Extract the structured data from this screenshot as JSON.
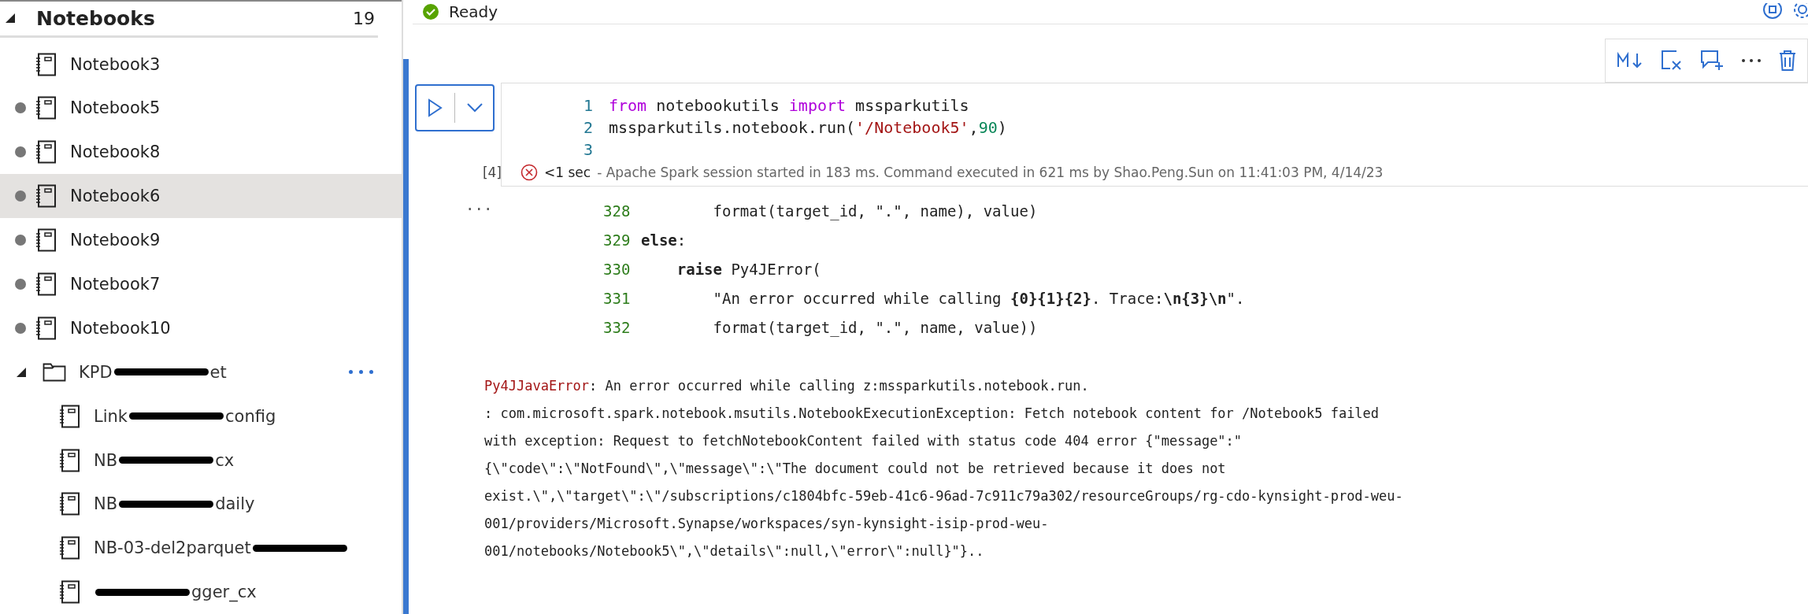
{
  "sidebar": {
    "section": {
      "title": "Notebooks",
      "count": "19",
      "expanded": true
    },
    "notebooks": [
      {
        "name": "Notebook3",
        "modified": false,
        "selected": false
      },
      {
        "name": "Notebook5",
        "modified": true,
        "selected": false
      },
      {
        "name": "Notebook8",
        "modified": true,
        "selected": false
      },
      {
        "name": "Notebook6",
        "modified": true,
        "selected": true
      },
      {
        "name": "Notebook9",
        "modified": true,
        "selected": false
      },
      {
        "name": "Notebook7",
        "modified": true,
        "selected": false
      },
      {
        "name": "Notebook10",
        "modified": true,
        "selected": false
      }
    ],
    "folder": {
      "name_start": "KPD",
      "name_end": "et",
      "expanded": true,
      "children": [
        {
          "name_start": "Link",
          "name_end": "config"
        },
        {
          "name_start": "NB",
          "name_end": "cx"
        },
        {
          "name_start": "NB",
          "name_end": "daily"
        },
        {
          "name_start": "NB-03-del2parquet"
        },
        {
          "name_end": "gger_cx"
        }
      ]
    }
  },
  "status": {
    "text": "Ready"
  },
  "cell": {
    "toolbar": [
      {
        "kind": "markdown"
      },
      {
        "kind": "clear-output"
      },
      {
        "kind": "comment"
      },
      {
        "kind": "more"
      },
      {
        "kind": "delete"
      }
    ],
    "execution_count": "[4]",
    "code": [
      {
        "number": "1",
        "tokens": [
          {
            "kind": "keyword",
            "text": "from"
          },
          {
            "kind": "plain",
            "text": " notebookutils "
          },
          {
            "kind": "keyword",
            "text": "import"
          },
          {
            "kind": "plain",
            "text": " mssparkutils"
          }
        ]
      },
      {
        "number": "2",
        "tokens": [
          {
            "kind": "plain",
            "text": "mssparkutils.notebook.run("
          },
          {
            "kind": "string",
            "text": "'/Notebook5'"
          },
          {
            "kind": "plain",
            "text": ","
          },
          {
            "kind": "number",
            "text": "90"
          },
          {
            "kind": "plain",
            "text": ")"
          }
        ]
      },
      {
        "number": "3"
      }
    ],
    "result": {
      "failed": true,
      "duration": "<1 sec",
      "message": "- Apache Spark session started in 183 ms. Command executed in 621 ms by Shao.Peng.Sun on 11:41:03 PM, 4/14/23"
    }
  },
  "output": {
    "collapsed_marker": "...",
    "traceback": [
      {
        "number": "328",
        "tokens": [
          {
            "kind": "plain",
            "text": "        format(target_id, \".\", name), value)"
          }
        ]
      },
      {
        "number": "329",
        "tokens": [
          {
            "kind": "bold",
            "text": "else"
          },
          {
            "kind": "plain",
            "text": ":"
          }
        ]
      },
      {
        "number": "330",
        "tokens": [
          {
            "kind": "bold",
            "text": "    raise"
          },
          {
            "kind": "plain",
            "text": " Py4JError("
          }
        ]
      },
      {
        "number": "331",
        "tokens": [
          {
            "kind": "plain",
            "text": "        \"An error occurred while calling "
          },
          {
            "kind": "bold",
            "text": "{0}{1}{2}"
          },
          {
            "kind": "plain",
            "text": ". Trace:"
          },
          {
            "kind": "bold",
            "text": "\\n{3}\\n"
          },
          {
            "kind": "plain",
            "text": "\"."
          }
        ]
      },
      {
        "number": "332",
        "tokens": [
          {
            "kind": "plain",
            "text": "        format(target_id, \".\", name, value))"
          }
        ]
      }
    ],
    "error_name": "Py4JJavaError",
    "error_lines": [
      ": An error occurred while calling z:mssparkutils.notebook.run.",
      ": com.microsoft.spark.notebook.msutils.NotebookExecutionException: Fetch notebook content for /Notebook5 failed",
      "with exception: Request to fetchNotebookContent failed with status code 404 error {\"message\":\"",
      "{\\\"code\\\":\\\"NotFound\\\",\\\"message\\\":\\\"The document could not be retrieved because it does not",
      "exist.\\\",\\\"target\\\":\\\"/subscriptions/c1804bfc-59eb-41c6-96ad-7c911c79a302/resourceGroups/rg-cdo-kynsight-prod-weu-",
      "001/providers/Microsoft.Synapse/workspaces/syn-kynsight-isip-prod-weu-",
      "001/notebooks/Notebook5\\\",\\\"details\\\":null,\\\"error\\\":null}\"}.."
    ]
  }
}
